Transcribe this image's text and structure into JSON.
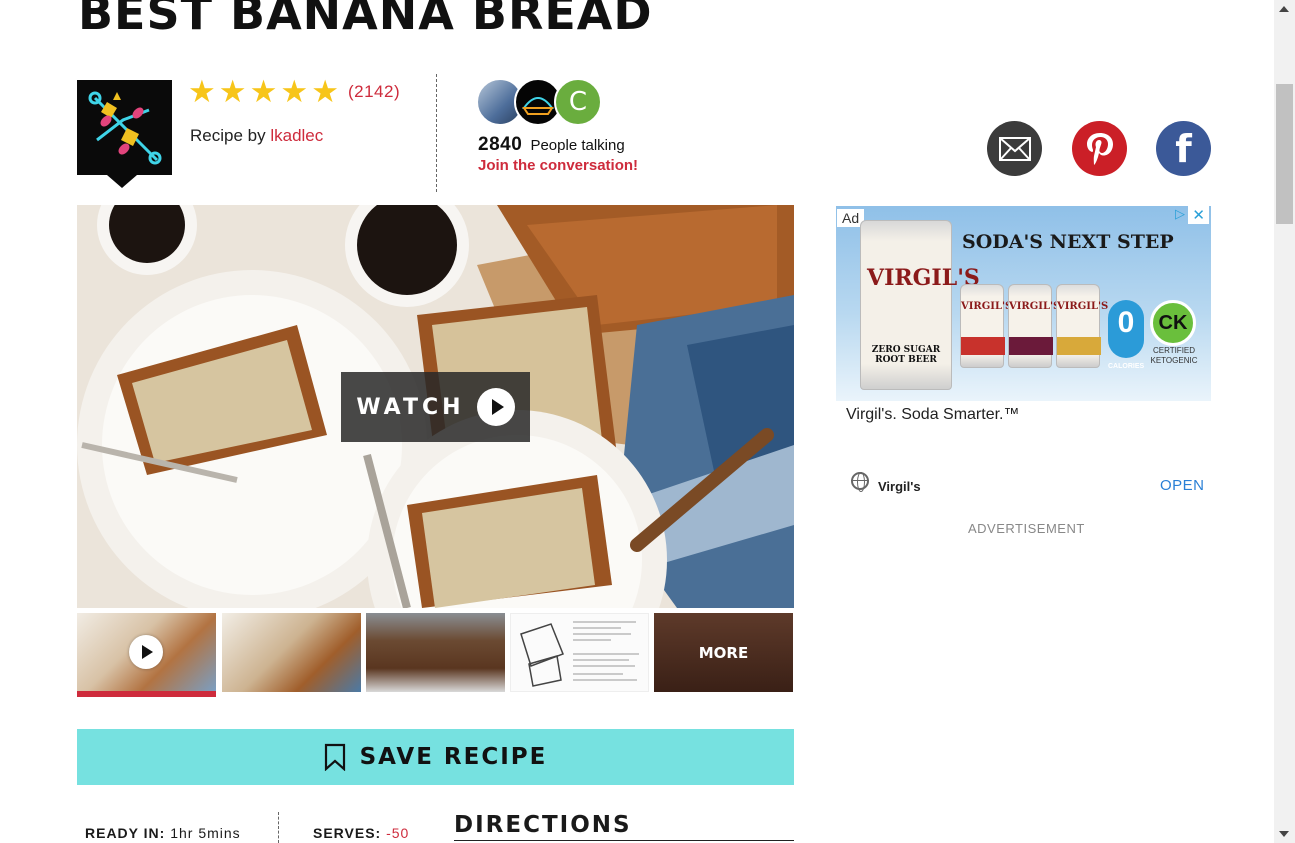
{
  "recipe": {
    "title": "BEST BANANA BREAD",
    "rating_stars": 5,
    "rating_count": "(2142)",
    "recipe_by_prefix": "Recipe by",
    "author": "lkadlec"
  },
  "conversation": {
    "count": "2840",
    "people_label": "People talking",
    "join_link": "Join the conversation!",
    "avatar3_initial": "C"
  },
  "social": {
    "icons": [
      "email-icon",
      "pinterest-icon",
      "facebook-icon"
    ],
    "facebook_glyph": "f"
  },
  "media": {
    "watch_label": "WATCH",
    "more_label": "MORE"
  },
  "actions": {
    "save_label": "SAVE RECIPE"
  },
  "details": {
    "ready_label": "READY IN:",
    "ready_value": "1hr 5mins",
    "serves_label": "SERVES:",
    "serves_value": "-50",
    "directions_heading": "DIRECTIONS"
  },
  "ad": {
    "tag": "Ad",
    "headline": "SODA'S NEXT STEP",
    "brand": "VIRGIL'S",
    "can_sub": "ZERO SUGAR ROOT BEER",
    "zero_badge": "0",
    "zero_label": "CALORIES",
    "ck_badge": "CK",
    "ck_label": "CERTIFIED KETOGENIC",
    "caption": "Virgil's. Soda Smarter.™",
    "advertiser": "Virgil's",
    "open_label": "OPEN",
    "advertisement_label": "ADVERTISEMENT"
  },
  "colors": {
    "accent_red": "#ce2b3c",
    "save_teal": "#76e1e0",
    "star_yellow": "#f7c51a",
    "facebook_blue": "#3b5998",
    "pinterest_red": "#cb1f27"
  }
}
